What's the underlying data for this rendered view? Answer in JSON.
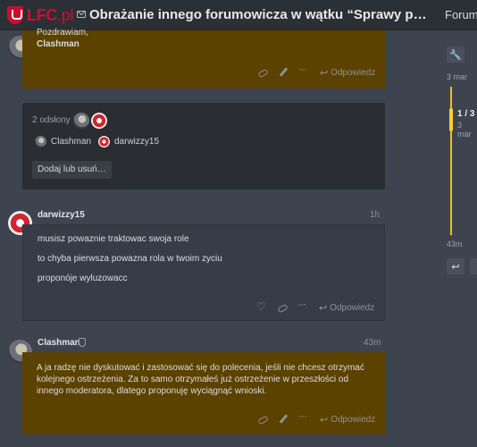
{
  "header": {
    "logo_main": "LFC",
    "logo_sub": ".pl",
    "topic_title": "Obrażanie innego forumowicza w wątku “Sprawy pozasportowe”",
    "nav_forum": "Forum"
  },
  "post_top": {
    "signoff": "Pozdrawiam,",
    "signature": "Clashman",
    "reply_label": "Odpowiedz"
  },
  "views_box": {
    "views_label": "2 odsłony",
    "users": [
      {
        "name": "Clashman"
      },
      {
        "name": "darwizzy15"
      }
    ],
    "add_remove_label": "Dodaj lub usuń…"
  },
  "post_darwizzy": {
    "username": "darwizzy15",
    "time": "1h",
    "lines": [
      "musisz powaznie traktowac swoja role",
      "to chyba pierwsza powazna rola w twoim zyciu",
      "proponóje wyluzowacc"
    ],
    "reply_label": "Odpowiedz"
  },
  "post_clashman": {
    "username": "Clashman",
    "time": "43m",
    "text": "A ja radzę nie dyskutować i zastosować się do polecenia, jeśli nie chcesz otrzymać kolejnego ostrzeżenia. Za to samo otrzymałeś już ostrzeżenie w przeszłości od innego moderatora, dlatego proponuję wyciągnąć wnioski.",
    "reply_label": "Odpowiedz"
  },
  "timeline": {
    "date_top": "3 mar",
    "counter": "1 / 3",
    "counter_date": "3 mar",
    "date_bottom": "43m"
  },
  "colors": {
    "background": "#3d4450",
    "moderator_post": "#5b4200",
    "accent_yellow": "#e8c21c",
    "brand_red": "#c8102e"
  }
}
